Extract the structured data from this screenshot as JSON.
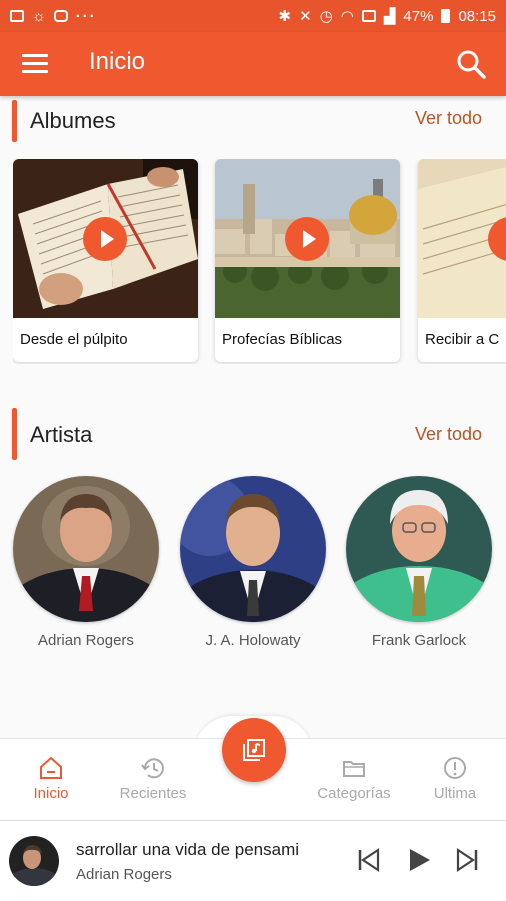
{
  "status_bar": {
    "battery": "47%",
    "time": "08:15",
    "more": "···"
  },
  "app_bar": {
    "title": "Inicio"
  },
  "albums": {
    "title": "Albumes",
    "see_all": "Ver todo",
    "items": [
      {
        "name": "Desde el púlpito"
      },
      {
        "name": "Profecías Bíblicas"
      },
      {
        "name": "Recibir a C"
      }
    ]
  },
  "artists": {
    "title": "Artista",
    "see_all": "Ver todo",
    "items": [
      {
        "name": "Adrian Rogers"
      },
      {
        "name": "J. A. Holowaty"
      },
      {
        "name": "Frank Garlock"
      }
    ]
  },
  "bottom_nav": {
    "items": [
      {
        "label": "Inicio",
        "icon": "home-icon",
        "active": true
      },
      {
        "label": "Recientes",
        "icon": "history-icon"
      },
      {
        "label": "Categorías",
        "icon": "folder-icon"
      },
      {
        "label": "Ultima",
        "icon": "alert-icon"
      }
    ],
    "center_icon": "music-library-icon"
  },
  "player": {
    "title": "sarrollar una vida de pensami",
    "artist": "Adrian Rogers"
  },
  "colors": {
    "accent": "#f0592f",
    "status_bar": "#e8552d",
    "link": "#c0521f"
  }
}
